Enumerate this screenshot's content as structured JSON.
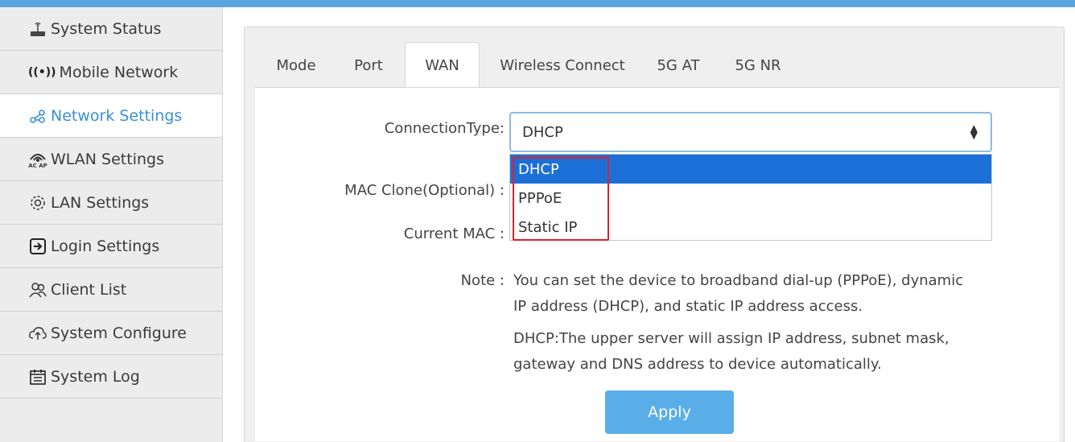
{
  "sidebar": {
    "items": [
      {
        "label": "System Status",
        "icon": "router-icon"
      },
      {
        "label": "Mobile Network",
        "icon": "signal-icon"
      },
      {
        "label": "Network Settings",
        "icon": "network-icon",
        "active": true
      },
      {
        "label": "WLAN Settings",
        "icon": "wifi-icon"
      },
      {
        "label": "LAN Settings",
        "icon": "gear-icon"
      },
      {
        "label": "Login Settings",
        "icon": "login-icon"
      },
      {
        "label": "Client List",
        "icon": "users-icon"
      },
      {
        "label": "System Configure",
        "icon": "upload-icon"
      },
      {
        "label": "System Log",
        "icon": "calendar-icon"
      }
    ],
    "wlan_icon_text": "AC AP",
    "mobile_icon_text": "((•))"
  },
  "tabs": [
    "Mode",
    "Port",
    "WAN",
    "Wireless Connect",
    "5G AT",
    "5G NR"
  ],
  "active_tab": "WAN",
  "form": {
    "connection_type_label": "ConnectionType:",
    "connection_type_value": "DHCP",
    "mac_clone_label": "MAC Clone(Optional) :",
    "current_mac_label": "Current MAC :",
    "options": [
      "DHCP",
      "PPPoE",
      "Static IP"
    ],
    "selected_option": "DHCP",
    "note_label": "Note :",
    "note_line1": "You can set the device to broadband dial-up (PPPoE), dynamic",
    "note_line2": "IP address (DHCP), and static IP address access.",
    "note_line3": "DHCP:The upper server will assign IP address, subnet mask,",
    "note_line4": "gateway and DNS address to device automatically.",
    "apply_label": "Apply"
  },
  "colors": {
    "accent": "#3a8fd6",
    "top_bar": "#5aa5e0",
    "option_selected": "#1c6fd6",
    "highlight_border": "#e0202a",
    "apply_button": "#5aaee8"
  }
}
